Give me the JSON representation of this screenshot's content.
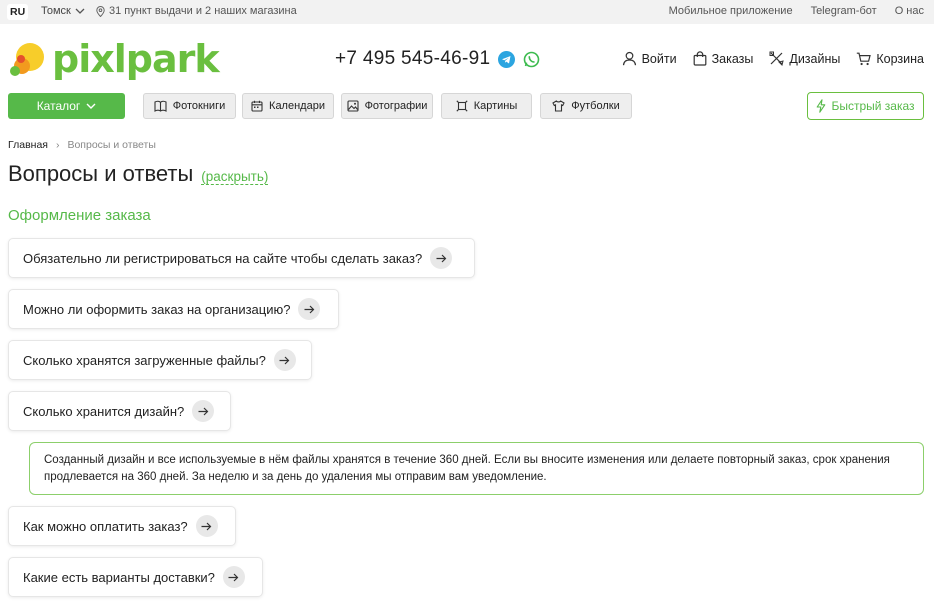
{
  "topbar": {
    "lang": "RU",
    "city": "Томск",
    "pickup": "31 пункт выдачи и 2 наших магазина",
    "links": [
      "Мобильное приложение",
      "Telegram-бот",
      "О нас"
    ]
  },
  "header": {
    "logo": "pixlpark",
    "phone": "+7 495 545-46-91",
    "nav": {
      "login": "Войти",
      "orders": "Заказы",
      "designs": "Дизайны",
      "cart": "Корзина"
    }
  },
  "navbar": {
    "catalog": "Каталог",
    "items": [
      "Фотокниги",
      "Календари",
      "Фотографии",
      "Картины",
      "Футболки"
    ],
    "quick_order": "Быстрый заказ"
  },
  "breadcrumb": {
    "home": "Главная",
    "current": "Вопросы и ответы"
  },
  "page": {
    "title": "Вопросы и ответы",
    "expand": "(раскрыть)",
    "section": "Оформление заказа"
  },
  "faq": [
    "Обязательно ли регистрироваться на сайте чтобы сделать заказ?",
    "Можно ли оформить заказ на организацию?",
    "Сколько хранятся загруженные файлы?",
    "Сколько хранится дизайн?",
    "Как можно оплатить заказ?",
    "Какие есть варианты доставки?"
  ],
  "answer": "Созданный дизайн и все используемые в нём файлы хранятся в течение 360 дней. Если вы вносите изменения или делаете повторный заказ, срок хранения продлевается на 360 дней. За неделю и за день до удаления мы отправим вам уведомление.",
  "colors": {
    "brand_green": "#56b949",
    "logo_green": "#6abf3f",
    "logo_orange": "#f29a1e",
    "logo_yellow": "#f7cd2a",
    "telegram_blue": "#2ca5e0",
    "whatsapp_green": "#3dbb4f"
  }
}
